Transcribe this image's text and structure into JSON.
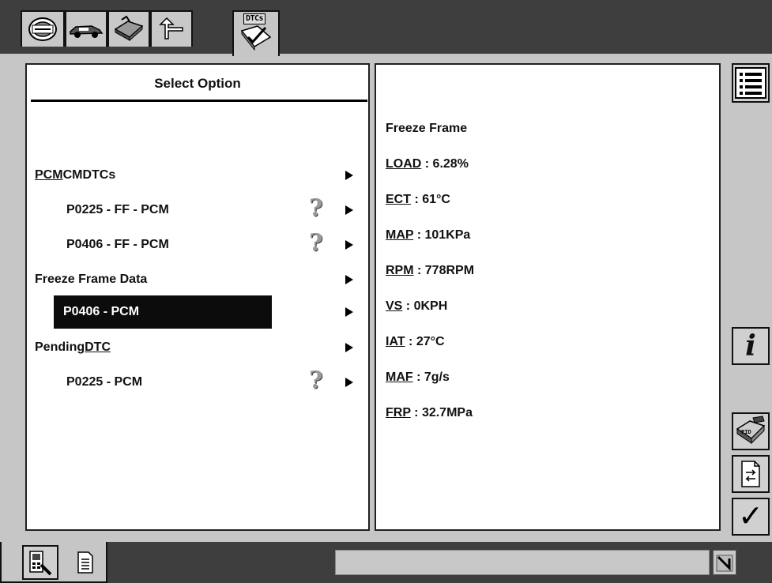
{
  "toolbar": {
    "tabs": [
      {
        "icon": "vehicle-wheel-icon"
      },
      {
        "icon": "car-icon"
      },
      {
        "icon": "toolbox-icon"
      },
      {
        "icon": "back-arrow-icon"
      },
      {
        "icon": "dtcs-checklist-icon",
        "label": "DTCs"
      }
    ]
  },
  "left_panel": {
    "title": "Select Option",
    "rows": [
      {
        "prefix": "PCM",
        "text": " CMDTCs"
      },
      {
        "text": "P0225 - FF - PCM",
        "help": true
      },
      {
        "text": "P0406 - FF - PCM",
        "help": true
      },
      {
        "text": "Freeze Frame Data"
      },
      {
        "text": "P0406 - PCM",
        "selected": true
      },
      {
        "text": "Pending ",
        "suffix": "DTC"
      },
      {
        "text": "P0225 - PCM",
        "help": true
      }
    ],
    "help_glyph": "?"
  },
  "right_panel": {
    "title": "Freeze Frame",
    "pids": [
      {
        "key": "LOAD",
        "value": " : 6.28%"
      },
      {
        "key": "ECT",
        "value": " : 61°C"
      },
      {
        "key": "MAP",
        "value": " : 101KPa"
      },
      {
        "key": "RPM",
        "value": " : 778RPM"
      },
      {
        "key": "VS",
        "value": " : 0KPH"
      },
      {
        "key": "IAT",
        "value": " : 27°C"
      },
      {
        "key": "MAF",
        "value": " : 7g/s"
      },
      {
        "key": "FRP",
        "value": " : 32.7MPa"
      }
    ]
  },
  "side_buttons": {
    "list": "list-menu-icon",
    "info": {
      "icon": "info-icon",
      "glyph": "i"
    },
    "pid": {
      "icon": "pid-edit-icon",
      "label": "PID"
    },
    "doc": "document-refresh-icon",
    "check": {
      "icon": "checkmark-icon",
      "glyph": "✓"
    }
  },
  "bottom": {
    "tab1": "scanner-tool-icon",
    "tab2": "document-icon",
    "status_text": "",
    "status_icon": "signal-icon"
  }
}
